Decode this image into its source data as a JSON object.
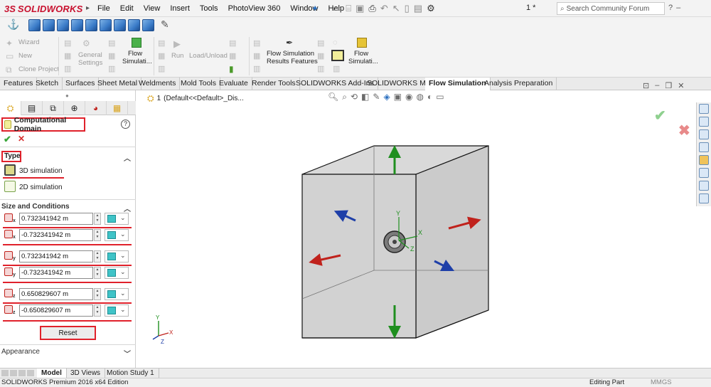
{
  "app": {
    "brand_prefix": "3S",
    "brand_name": "SOLIDWORKS"
  },
  "menu": {
    "items": [
      "File",
      "Edit",
      "View",
      "Insert",
      "Tools",
      "PhotoView 360",
      "Window",
      "Help"
    ]
  },
  "document_title": "1 *",
  "search": {
    "placeholder": "Search Community Forum"
  },
  "command_manager": {
    "wizard": "Wizard",
    "new": "New",
    "clone_project": "Clone Project",
    "general_settings_1": "General",
    "general_settings_2": "Settings",
    "flow_sim_1": "Flow",
    "flow_sim_2": "Simulati...",
    "run": "Run",
    "load_unload": "Load/Unload",
    "results_1": "Flow Simulation",
    "results_2": "Results Features",
    "flow_sim_b1": "Flow",
    "flow_sim_b2": "Simulati..."
  },
  "tabs": [
    "Features",
    "Sketch",
    "Surfaces",
    "Sheet Metal",
    "Weldments",
    "Mold Tools",
    "Evaluate",
    "Render Tools",
    "SOLIDWORKS Add-Ins",
    "SOLIDWORKS MBD",
    "Flow Simulation",
    "Analysis Preparation"
  ],
  "active_tab": "Flow Simulation",
  "tree": {
    "node_number": "1",
    "node_text": "(Default<<Default>_Dis..."
  },
  "property_manager": {
    "title": "Computational Domain",
    "type_section": "Type",
    "option_3d": "3D simulation",
    "option_2d": "2D simulation",
    "size_section": "Size and Conditions",
    "coords": [
      {
        "axis": "x",
        "value": "0.732341942 m"
      },
      {
        "axis": "x",
        "value": "-0.732341942 m"
      },
      {
        "axis": "y",
        "value": "0.732341942 m"
      },
      {
        "axis": "y",
        "value": "-0.732341942 m"
      },
      {
        "axis": "z",
        "value": "0.650829607 m"
      },
      {
        "axis": "z",
        "value": "-0.650829607 m"
      }
    ],
    "reset_label": "Reset",
    "appearance_section": "Appearance"
  },
  "triad_labels": {
    "x": "X",
    "y": "Y",
    "z": "Z"
  },
  "bottom_tabs": [
    "Model",
    "3D Views",
    "Motion Study 1"
  ],
  "status": {
    "left": "SOLIDWORKS Premium 2016 x64 Edition",
    "mode": "Editing Part",
    "units": "MMGS"
  },
  "colors": {
    "accent_red": "#e0212b",
    "brand_red": "#c8102e",
    "axis_green": "#1f8f1f",
    "axis_red": "#c0221c",
    "axis_blue": "#1e3fa8"
  }
}
